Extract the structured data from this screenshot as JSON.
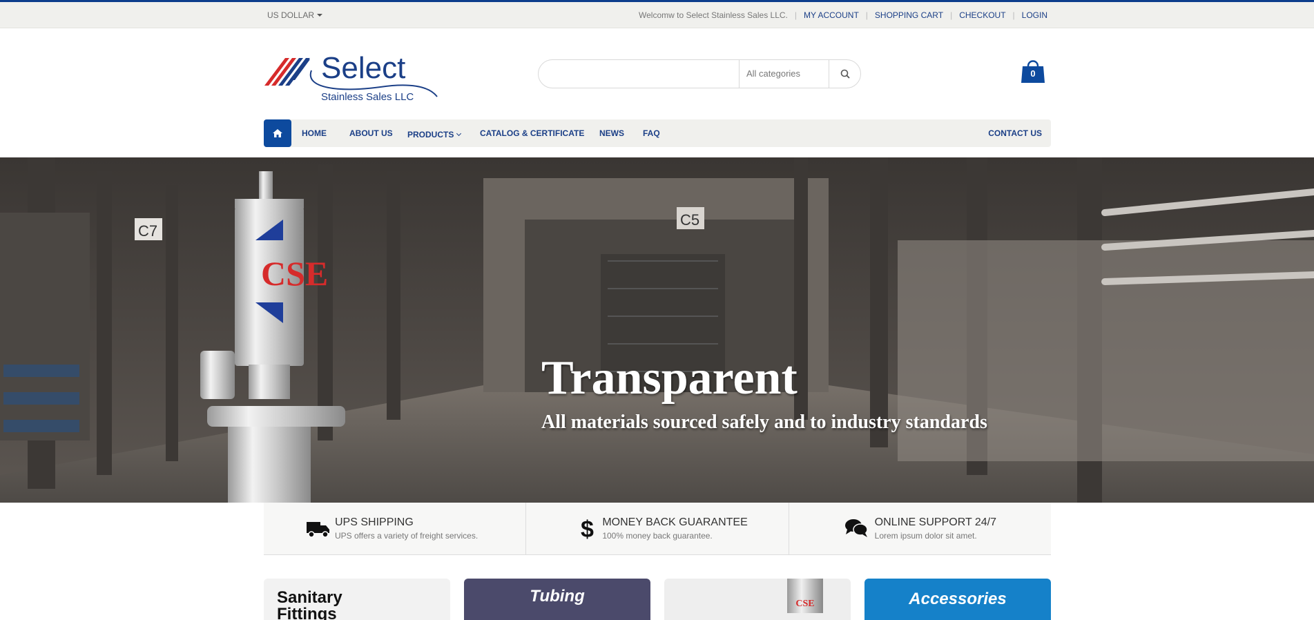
{
  "topbar": {
    "currency": "US DOLLAR",
    "welcome": "Welcomw to Select Stainless Sales LLC.",
    "links": [
      "MY ACCOUNT",
      "SHOPPING CART",
      "CHECKOUT",
      "LOGIN"
    ]
  },
  "logo": {
    "brand": "Select",
    "tagline": "Stainless Sales LLC"
  },
  "search": {
    "placeholder": "",
    "category": "All categories",
    "icon": "search-icon"
  },
  "cart": {
    "count": "0",
    "icon": "shopping-bag-icon"
  },
  "nav": {
    "home_icon": "home-icon",
    "items": [
      "HOME",
      "ABOUT US",
      "PRODUCTS",
      "CATALOG & CERTIFICATE",
      "NEWS",
      "FAQ"
    ],
    "contact": "CONTACT US"
  },
  "hero": {
    "title": "Transparent",
    "subtitle": "All materials sourced safely and to industry standards",
    "product_label": "CSE",
    "sign_left": "C7",
    "sign_center": "C5"
  },
  "features": [
    {
      "icon": "truck-icon",
      "title": "UPS SHIPPING",
      "desc": "UPS offers a variety of freight services."
    },
    {
      "icon": "dollar-icon",
      "title": "MONEY BACK GUARANTEE",
      "desc": "100% money back guarantee."
    },
    {
      "icon": "chat-icon",
      "title": "ONLINE SUPPORT 24/7",
      "desc": "Lorem ipsum dolor sit amet."
    }
  ],
  "categories": [
    {
      "title": "Sanitary",
      "title2": "Fittings",
      "bg": "#f2f2f2",
      "color": "#111111"
    },
    {
      "title": "Tubing",
      "bg": "#4b4a6b",
      "color": "#ffffff"
    },
    {
      "title": "",
      "bg": "#eeeeee",
      "color": "#111111",
      "label": "CSE"
    },
    {
      "title": "Accessories",
      "bg": "#1581c9",
      "color": "#ffffff"
    }
  ],
  "colors": {
    "brand_blue": "#1b3f87",
    "accent_red": "#d62b2b",
    "nav_bg": "#f0f0ed"
  }
}
